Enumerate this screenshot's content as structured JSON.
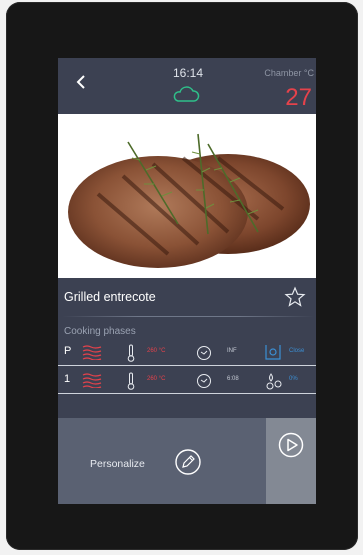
{
  "status": {
    "time": "16:14",
    "chamber_label": "Chamber °C",
    "chamber_value": "27"
  },
  "recipe": {
    "name": "Grilled entrecote"
  },
  "phases": {
    "label": "Cooking phases",
    "rows": [
      {
        "id": "P",
        "temp": "260 °C",
        "time": "INF",
        "extra": "Close",
        "extra_icon": "damper-icon"
      },
      {
        "id": "1",
        "temp": "260 °C",
        "time": "6:08",
        "extra": "0%",
        "extra_icon": "humidity-icon"
      }
    ]
  },
  "footer": {
    "personalize_label": "Personalize"
  },
  "colors": {
    "screen_bg": "#3c4152",
    "accent_red": "#e5424b",
    "accent_blue": "#3b8fd4",
    "bottom_bg": "#5a6172",
    "start_bg": "#838994"
  }
}
